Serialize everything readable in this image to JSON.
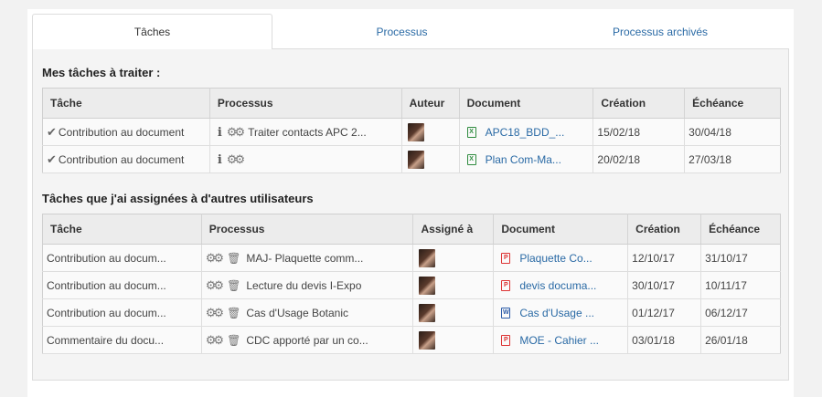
{
  "tabs": [
    {
      "label": "Tâches",
      "active": true
    },
    {
      "label": "Processus",
      "active": false
    },
    {
      "label": "Processus archivés",
      "active": false
    }
  ],
  "section1": {
    "title": "Mes tâches à traiter :",
    "headers": [
      "Tâche",
      "Processus",
      "Auteur",
      "Document",
      "Création",
      "Échéance"
    ],
    "rows": [
      {
        "task": "Contribution au document",
        "process": "Traiter contacts APC 2...",
        "document": "APC18_BDD_...",
        "doc_type": "xls",
        "created": "15/02/18",
        "due": "30/04/18"
      },
      {
        "task": "Contribution au document",
        "process": "",
        "document": "Plan Com-Ma...",
        "doc_type": "xls",
        "created": "20/02/18",
        "due": "27/03/18"
      }
    ]
  },
  "section2": {
    "title": "Tâches que j'ai assignées à d'autres utilisateurs",
    "headers": [
      "Tâche",
      "Processus",
      "Assigné à",
      "Document",
      "Création",
      "Échéance"
    ],
    "rows": [
      {
        "task": "Contribution au docum...",
        "process": "MAJ- Plaquette comm...",
        "document": "Plaquette Co...",
        "doc_type": "pdf",
        "created": "12/10/17",
        "due": "31/10/17"
      },
      {
        "task": "Contribution au docum...",
        "process": "Lecture du devis I-Expo",
        "document": "devis documa...",
        "doc_type": "pdf",
        "created": "30/10/17",
        "due": "10/11/17"
      },
      {
        "task": "Contribution au docum...",
        "process": "Cas d'Usage Botanic",
        "document": "Cas d'Usage ...",
        "doc_type": "doc",
        "created": "01/12/17",
        "due": "06/12/17"
      },
      {
        "task": "Commentaire du docu...",
        "process": "CDC apporté par un co...",
        "document": "MOE - Cahier ...",
        "doc_type": "pdf",
        "created": "03/01/18",
        "due": "26/01/18"
      }
    ]
  },
  "colors": {
    "link": "#2a6aa5",
    "xls": "#2e8b3e",
    "pdf": "#dd3333",
    "doc": "#2a5aa8"
  }
}
